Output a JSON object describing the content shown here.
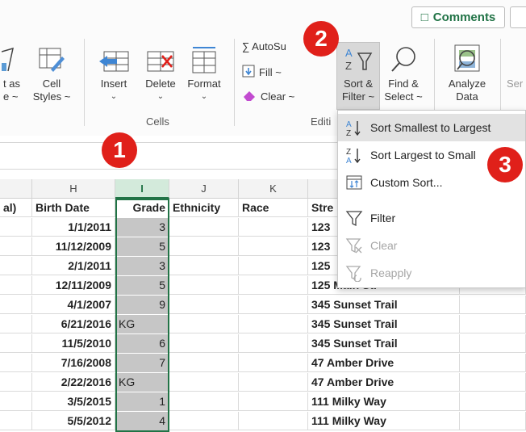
{
  "ribbon": {
    "comments_label": "Comments",
    "format_as_table": {
      "line1": "t as",
      "line2": "e ~"
    },
    "cell_styles": {
      "line1": "Cell",
      "line2": "Styles ~"
    },
    "insert_label": "Insert",
    "delete_label": "Delete",
    "format_label": "Format",
    "cells_group_label": "Cells",
    "autosum_label": "∑ AutoSu",
    "fill_label": "Fill ~",
    "clear_label": "Clear ~",
    "editing_group_label": "Editi",
    "sort_filter": {
      "line1": "Sort &",
      "line2": "Filter ~"
    },
    "find_select": {
      "line1": "Find &",
      "line2": "Select ~"
    },
    "analyze_data": {
      "line1": "Analyze",
      "line2": "Data"
    },
    "sensitivity_label": "Ser"
  },
  "menu": {
    "items": [
      {
        "label": "Sort Smallest to Largest",
        "icon": "sort-ascending-icon",
        "highlighted": true
      },
      {
        "label": "Sort Largest to Small",
        "icon": "sort-descending-icon"
      },
      {
        "label": "Custom Sort...",
        "icon": "custom-sort-icon"
      },
      {
        "label": "Filter",
        "icon": "filter-icon"
      },
      {
        "label": "Clear",
        "icon": "clear-filter-icon",
        "disabled": true
      },
      {
        "label": "Reapply",
        "icon": "reapply-icon",
        "disabled": true
      }
    ]
  },
  "badges": {
    "one": "1",
    "two": "2",
    "three": "3"
  },
  "columns": {
    "g": "",
    "h": "H",
    "i": "I",
    "j": "J",
    "k": "K",
    "l": ""
  },
  "headers": {
    "g": "al)",
    "h": "Birth Date",
    "i": "Grade",
    "j": "Ethnicity",
    "k": "Race",
    "l": "Stre"
  },
  "rows": [
    {
      "birth": "1/1/2011",
      "grade": "3",
      "street": "123"
    },
    {
      "birth": "11/12/2009",
      "grade": "5",
      "street": "123"
    },
    {
      "birth": "2/1/2011",
      "grade": "3",
      "street": "125"
    },
    {
      "birth": "12/11/2009",
      "grade": "5",
      "street": "125 Main St."
    },
    {
      "birth": "4/1/2007",
      "grade": "9",
      "street": "345 Sunset Trail"
    },
    {
      "birth": "6/21/2016",
      "grade": "KG",
      "street": "345 Sunset Trail"
    },
    {
      "birth": "11/5/2010",
      "grade": "6",
      "street": "345 Sunset Trail"
    },
    {
      "birth": "7/16/2008",
      "grade": "7",
      "street": "47 Amber Drive"
    },
    {
      "birth": "2/22/2016",
      "grade": "KG",
      "street": "47 Amber Drive"
    },
    {
      "birth": "3/5/2015",
      "grade": "1",
      "street": "111 Milky Way"
    },
    {
      "birth": "5/5/2012",
      "grade": "4",
      "street": "111 Milky Way"
    }
  ],
  "colors": {
    "accent": "#217346",
    "badge": "#e0201a",
    "selection": "#c6c6c6"
  }
}
